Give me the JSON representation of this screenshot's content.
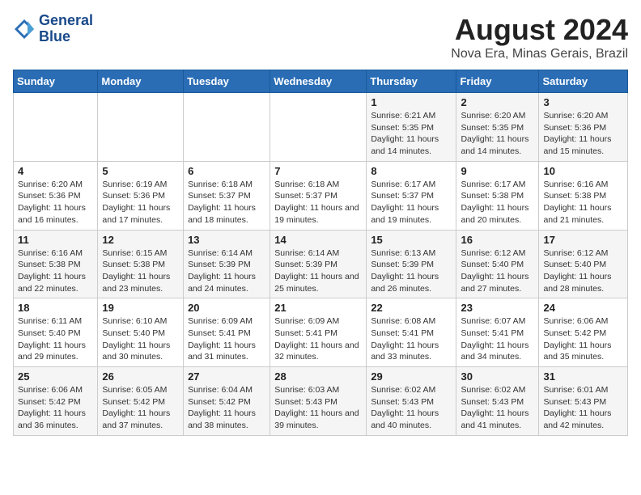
{
  "header": {
    "logo_line1": "General",
    "logo_line2": "Blue",
    "title": "August 2024",
    "subtitle": "Nova Era, Minas Gerais, Brazil"
  },
  "days_of_week": [
    "Sunday",
    "Monday",
    "Tuesday",
    "Wednesday",
    "Thursday",
    "Friday",
    "Saturday"
  ],
  "weeks": [
    [
      {
        "day": "",
        "text": ""
      },
      {
        "day": "",
        "text": ""
      },
      {
        "day": "",
        "text": ""
      },
      {
        "day": "",
        "text": ""
      },
      {
        "day": "1",
        "text": "Sunrise: 6:21 AM\nSunset: 5:35 PM\nDaylight: 11 hours and 14 minutes."
      },
      {
        "day": "2",
        "text": "Sunrise: 6:20 AM\nSunset: 5:35 PM\nDaylight: 11 hours and 14 minutes."
      },
      {
        "day": "3",
        "text": "Sunrise: 6:20 AM\nSunset: 5:36 PM\nDaylight: 11 hours and 15 minutes."
      }
    ],
    [
      {
        "day": "4",
        "text": "Sunrise: 6:20 AM\nSunset: 5:36 PM\nDaylight: 11 hours and 16 minutes."
      },
      {
        "day": "5",
        "text": "Sunrise: 6:19 AM\nSunset: 5:36 PM\nDaylight: 11 hours and 17 minutes."
      },
      {
        "day": "6",
        "text": "Sunrise: 6:18 AM\nSunset: 5:37 PM\nDaylight: 11 hours and 18 minutes."
      },
      {
        "day": "7",
        "text": "Sunrise: 6:18 AM\nSunset: 5:37 PM\nDaylight: 11 hours and 19 minutes."
      },
      {
        "day": "8",
        "text": "Sunrise: 6:17 AM\nSunset: 5:37 PM\nDaylight: 11 hours and 19 minutes."
      },
      {
        "day": "9",
        "text": "Sunrise: 6:17 AM\nSunset: 5:38 PM\nDaylight: 11 hours and 20 minutes."
      },
      {
        "day": "10",
        "text": "Sunrise: 6:16 AM\nSunset: 5:38 PM\nDaylight: 11 hours and 21 minutes."
      }
    ],
    [
      {
        "day": "11",
        "text": "Sunrise: 6:16 AM\nSunset: 5:38 PM\nDaylight: 11 hours and 22 minutes."
      },
      {
        "day": "12",
        "text": "Sunrise: 6:15 AM\nSunset: 5:38 PM\nDaylight: 11 hours and 23 minutes."
      },
      {
        "day": "13",
        "text": "Sunrise: 6:14 AM\nSunset: 5:39 PM\nDaylight: 11 hours and 24 minutes."
      },
      {
        "day": "14",
        "text": "Sunrise: 6:14 AM\nSunset: 5:39 PM\nDaylight: 11 hours and 25 minutes."
      },
      {
        "day": "15",
        "text": "Sunrise: 6:13 AM\nSunset: 5:39 PM\nDaylight: 11 hours and 26 minutes."
      },
      {
        "day": "16",
        "text": "Sunrise: 6:12 AM\nSunset: 5:40 PM\nDaylight: 11 hours and 27 minutes."
      },
      {
        "day": "17",
        "text": "Sunrise: 6:12 AM\nSunset: 5:40 PM\nDaylight: 11 hours and 28 minutes."
      }
    ],
    [
      {
        "day": "18",
        "text": "Sunrise: 6:11 AM\nSunset: 5:40 PM\nDaylight: 11 hours and 29 minutes."
      },
      {
        "day": "19",
        "text": "Sunrise: 6:10 AM\nSunset: 5:40 PM\nDaylight: 11 hours and 30 minutes."
      },
      {
        "day": "20",
        "text": "Sunrise: 6:09 AM\nSunset: 5:41 PM\nDaylight: 11 hours and 31 minutes."
      },
      {
        "day": "21",
        "text": "Sunrise: 6:09 AM\nSunset: 5:41 PM\nDaylight: 11 hours and 32 minutes."
      },
      {
        "day": "22",
        "text": "Sunrise: 6:08 AM\nSunset: 5:41 PM\nDaylight: 11 hours and 33 minutes."
      },
      {
        "day": "23",
        "text": "Sunrise: 6:07 AM\nSunset: 5:41 PM\nDaylight: 11 hours and 34 minutes."
      },
      {
        "day": "24",
        "text": "Sunrise: 6:06 AM\nSunset: 5:42 PM\nDaylight: 11 hours and 35 minutes."
      }
    ],
    [
      {
        "day": "25",
        "text": "Sunrise: 6:06 AM\nSunset: 5:42 PM\nDaylight: 11 hours and 36 minutes."
      },
      {
        "day": "26",
        "text": "Sunrise: 6:05 AM\nSunset: 5:42 PM\nDaylight: 11 hours and 37 minutes."
      },
      {
        "day": "27",
        "text": "Sunrise: 6:04 AM\nSunset: 5:42 PM\nDaylight: 11 hours and 38 minutes."
      },
      {
        "day": "28",
        "text": "Sunrise: 6:03 AM\nSunset: 5:43 PM\nDaylight: 11 hours and 39 minutes."
      },
      {
        "day": "29",
        "text": "Sunrise: 6:02 AM\nSunset: 5:43 PM\nDaylight: 11 hours and 40 minutes."
      },
      {
        "day": "30",
        "text": "Sunrise: 6:02 AM\nSunset: 5:43 PM\nDaylight: 11 hours and 41 minutes."
      },
      {
        "day": "31",
        "text": "Sunrise: 6:01 AM\nSunset: 5:43 PM\nDaylight: 11 hours and 42 minutes."
      }
    ]
  ]
}
